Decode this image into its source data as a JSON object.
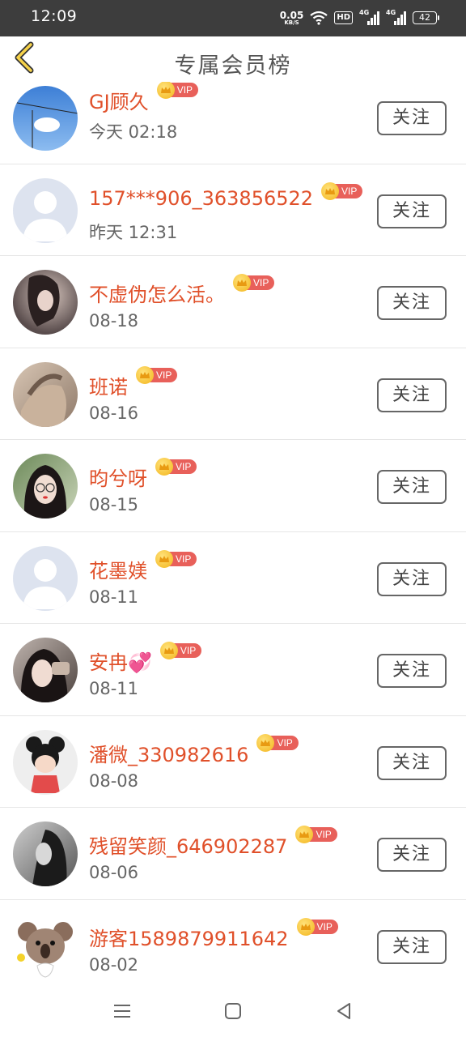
{
  "status_bar": {
    "time": "12:09",
    "speed_value": "0.05",
    "speed_unit": "KB/S",
    "hd_label": "HD",
    "signal1_label": "4G",
    "signal2_label": "4G",
    "battery": "42"
  },
  "header": {
    "title": "专属会员榜",
    "back_icon": "chevron-left-icon"
  },
  "vip_label": "VIP",
  "follow_label": "关注",
  "members": [
    {
      "name": "GJ顾久",
      "time": "今天 02:18"
    },
    {
      "name": "157***906_363856522",
      "time": "昨天 12:31"
    },
    {
      "name": "不虚伪怎么活。",
      "time": "08-18"
    },
    {
      "name": "班诺",
      "time": "08-16"
    },
    {
      "name": "昀兮呀",
      "time": "08-15"
    },
    {
      "name": "花墨媄",
      "time": "08-11"
    },
    {
      "name": "安冉💞",
      "time": "08-11"
    },
    {
      "name": "潘微_330982616",
      "time": "08-08"
    },
    {
      "name": "残留笑颜_646902287",
      "time": "08-06"
    },
    {
      "name": "游客1589879911642",
      "time": "08-02"
    }
  ],
  "nav_icons": [
    "menu-icon",
    "home-square-icon",
    "back-triangle-icon"
  ],
  "colors": {
    "accent_name": "#e0502a",
    "vip_tag": "#e8605a",
    "crown": "#f3b51c",
    "status_bar": "#3d3d3d"
  }
}
